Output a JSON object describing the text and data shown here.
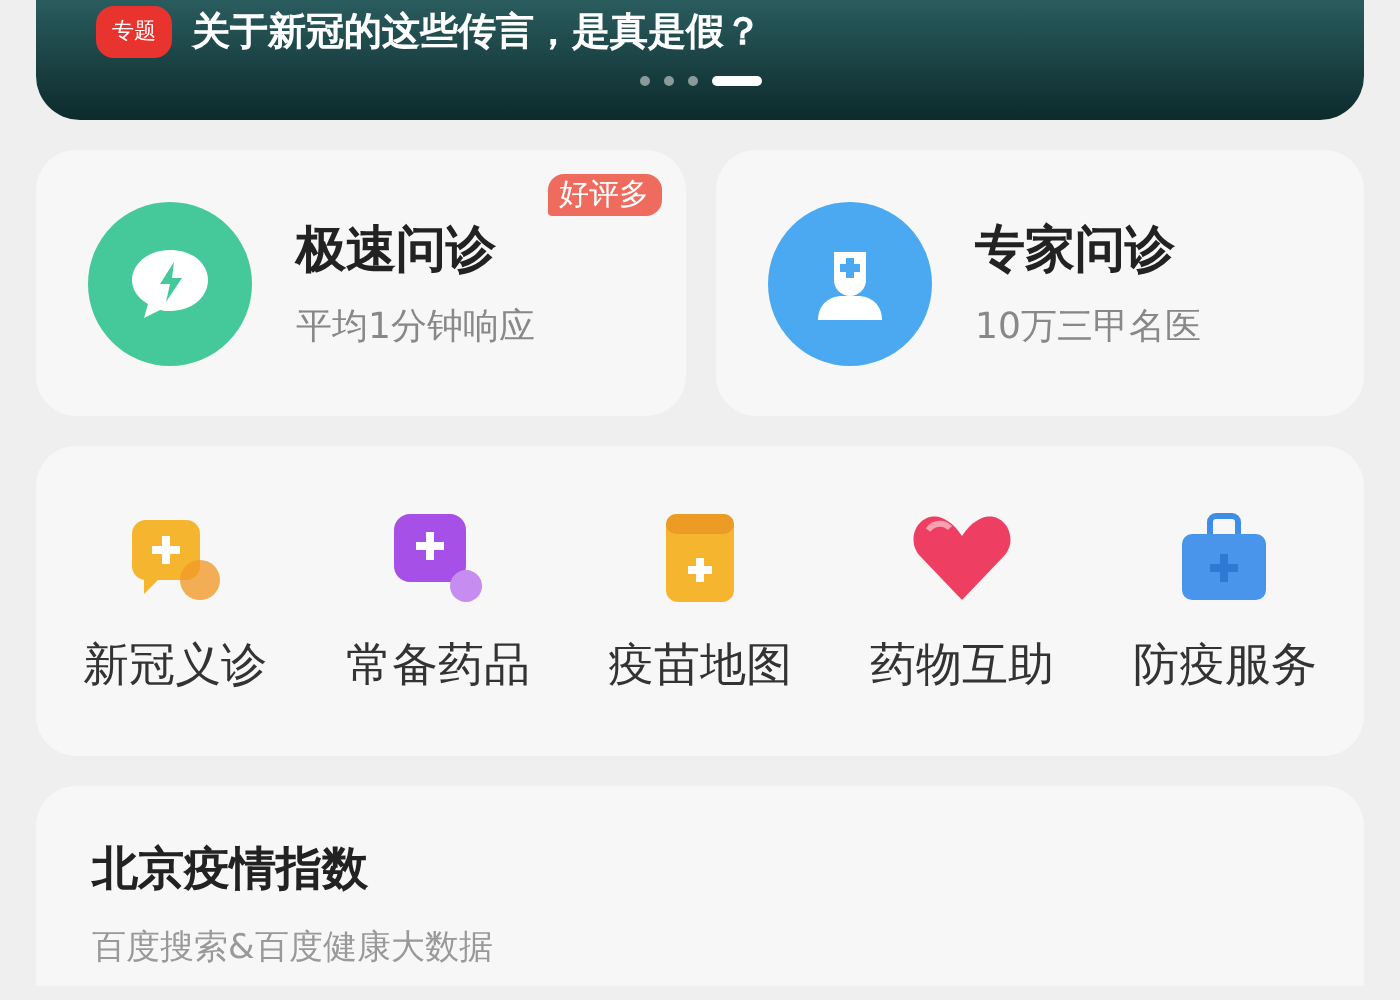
{
  "banner": {
    "tag": "专题",
    "headline": "关于新冠的这些传言，是真是假？",
    "dots": [
      {
        "selected": false
      },
      {
        "selected": false
      },
      {
        "selected": false
      },
      {
        "selected": true
      }
    ]
  },
  "services": [
    {
      "kind": "quick",
      "title": "极速问诊",
      "subtitle": "平均1分钟响应",
      "badge": "好评多"
    },
    {
      "kind": "expert",
      "title": "专家问诊",
      "subtitle": "10万三甲名医"
    }
  ],
  "shortcuts": [
    {
      "kind": "clinic",
      "label": "新冠义诊"
    },
    {
      "kind": "medicine",
      "label": "常备药品"
    },
    {
      "kind": "vaccine",
      "label": "疫苗地图"
    },
    {
      "kind": "mutual",
      "label": "药物互助"
    },
    {
      "kind": "service",
      "label": "防疫服务"
    }
  ],
  "index_card": {
    "title": "北京疫情指数",
    "subtitle": "百度搜索&百度健康大数据"
  }
}
